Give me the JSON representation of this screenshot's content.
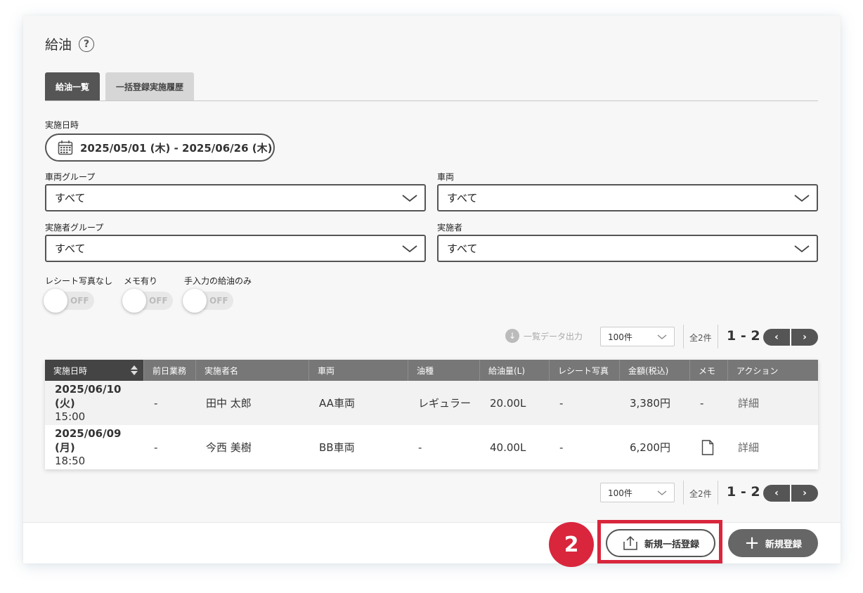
{
  "page": {
    "title": "給油",
    "help_icon": "question-circle-icon"
  },
  "tabs": [
    {
      "label": "給油一覧",
      "active": true
    },
    {
      "label": "一括登録実施履歴",
      "active": false
    }
  ],
  "filters": {
    "date_label": "実施日時",
    "date_range": "2025/05/01 (木) - 2025/06/26 (木)",
    "vehicle_group_label": "車両グループ",
    "vehicle_group_value": "すべて",
    "vehicle_label": "車両",
    "vehicle_value": "すべて",
    "operator_group_label": "実施者グループ",
    "operator_group_value": "すべて",
    "operator_label": "実施者",
    "operator_value": "すべて"
  },
  "toggles": [
    {
      "label": "レシート写真なし",
      "state": "OFF"
    },
    {
      "label": "メモ有り",
      "state": "OFF"
    },
    {
      "label": "手入力の給油のみ",
      "state": "OFF"
    }
  ],
  "list_controls": {
    "download_label": "一覧データ出力",
    "per_page": "100件",
    "total": "全2件",
    "range": "1 - 2",
    "prev": "‹",
    "next": "›"
  },
  "table": {
    "headers": [
      "実施日時",
      "前日業務",
      "実施者名",
      "車両",
      "油種",
      "給油量(L)",
      "レシート写真",
      "金額(税込)",
      "メモ",
      "アクション"
    ],
    "rows": [
      {
        "date": "2025/06/10 (火)",
        "time": "15:00",
        "prev_day": "-",
        "operator": "田中 太郎",
        "vehicle": "AA車両",
        "fuel": "レギュラー",
        "amount": "20.00L",
        "receipt": "-",
        "price": "3,380円",
        "memo": "-",
        "action": "詳細"
      },
      {
        "date": "2025/06/09 (月)",
        "time": "18:50",
        "prev_day": "-",
        "operator": "今西 美樹",
        "vehicle": "BB車両",
        "fuel": "-",
        "amount": "40.00L",
        "receipt": "-",
        "price": "6,200円",
        "memo": "document-icon",
        "action": "詳細"
      }
    ]
  },
  "footer": {
    "badge": "2",
    "bulk_button": "新規一括登録",
    "new_button": "新規登録"
  },
  "colors": {
    "accent": "#d9263d",
    "dark": "#555555"
  }
}
